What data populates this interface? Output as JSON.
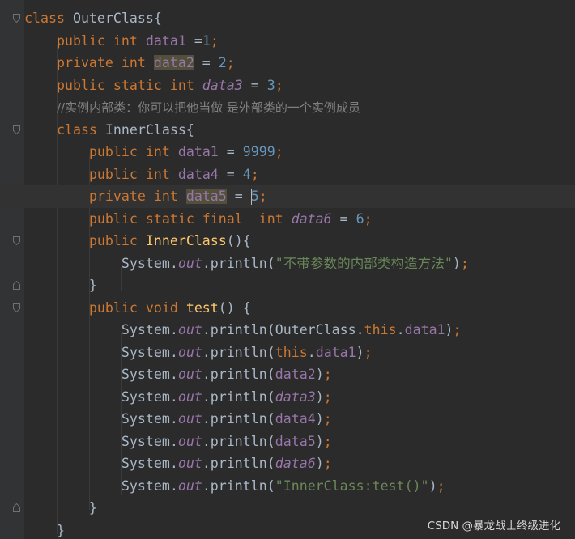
{
  "editor": {
    "lines": [
      {
        "fold": "open",
        "tokens": [
          {
            "t": "kw",
            "v": "class "
          },
          {
            "t": "plain",
            "v": "OuterClass{"
          }
        ]
      },
      {
        "tokens": [
          {
            "t": "plain",
            "v": "    "
          },
          {
            "t": "kw",
            "v": "public int "
          },
          {
            "t": "inst",
            "v": "data1 "
          },
          {
            "t": "plain",
            "v": "="
          },
          {
            "t": "num",
            "v": "1"
          },
          {
            "t": "kw",
            "v": ";"
          }
        ]
      },
      {
        "tokens": [
          {
            "t": "plain",
            "v": "    "
          },
          {
            "t": "kw",
            "v": "private int "
          },
          {
            "t": "inst",
            "v": "data2",
            "hl": true
          },
          {
            "t": "plain",
            "v": " = "
          },
          {
            "t": "num",
            "v": "2"
          },
          {
            "t": "kw",
            "v": ";"
          }
        ]
      },
      {
        "tokens": [
          {
            "t": "plain",
            "v": "    "
          },
          {
            "t": "kw",
            "v": "public static int "
          },
          {
            "t": "static",
            "v": "data3"
          },
          {
            "t": "plain",
            "v": " = "
          },
          {
            "t": "num",
            "v": "3"
          },
          {
            "t": "kw",
            "v": ";"
          }
        ]
      },
      {
        "tokens": [
          {
            "t": "plain",
            "v": "    "
          },
          {
            "t": "com",
            "v": "//实例内部类：你可以把他当做 是外部类的一个实例成员"
          }
        ]
      },
      {
        "fold": "open",
        "tokens": [
          {
            "t": "plain",
            "v": "    "
          },
          {
            "t": "kw",
            "v": "class "
          },
          {
            "t": "plain",
            "v": "InnerClass{"
          }
        ]
      },
      {
        "tokens": [
          {
            "t": "plain",
            "v": "        "
          },
          {
            "t": "kw",
            "v": "public int "
          },
          {
            "t": "inst",
            "v": "data1"
          },
          {
            "t": "plain",
            "v": " = "
          },
          {
            "t": "num",
            "v": "9999"
          },
          {
            "t": "kw",
            "v": ";"
          }
        ]
      },
      {
        "tokens": [
          {
            "t": "plain",
            "v": "        "
          },
          {
            "t": "kw",
            "v": "public int "
          },
          {
            "t": "inst",
            "v": "data4"
          },
          {
            "t": "plain",
            "v": " = "
          },
          {
            "t": "num",
            "v": "4"
          },
          {
            "t": "kw",
            "v": ";"
          }
        ]
      },
      {
        "current": true,
        "tokens": [
          {
            "t": "plain",
            "v": "        "
          },
          {
            "t": "kw",
            "v": "private int "
          },
          {
            "t": "inst",
            "v": "data5",
            "hl": true
          },
          {
            "t": "plain",
            "v": " = "
          },
          {
            "t": "caret",
            "v": ""
          },
          {
            "t": "num",
            "v": "5"
          },
          {
            "t": "kw",
            "v": ";"
          }
        ]
      },
      {
        "tokens": [
          {
            "t": "plain",
            "v": "        "
          },
          {
            "t": "kw",
            "v": "public static final  int "
          },
          {
            "t": "static",
            "v": "data6"
          },
          {
            "t": "plain",
            "v": " = "
          },
          {
            "t": "num",
            "v": "6"
          },
          {
            "t": "kw",
            "v": ";"
          }
        ]
      },
      {
        "fold": "open",
        "tokens": [
          {
            "t": "plain",
            "v": "        "
          },
          {
            "t": "kw",
            "v": "public "
          },
          {
            "t": "fn",
            "v": "InnerClass"
          },
          {
            "t": "plain",
            "v": "(){"
          }
        ]
      },
      {
        "tokens": [
          {
            "t": "plain",
            "v": "            System."
          },
          {
            "t": "static",
            "v": "out"
          },
          {
            "t": "plain",
            "v": ".println("
          },
          {
            "t": "str",
            "v": "\"不带参数的内部类构造方法\""
          },
          {
            "t": "plain",
            "v": ")"
          },
          {
            "t": "kw",
            "v": ";"
          }
        ]
      },
      {
        "fold": "close",
        "tokens": [
          {
            "t": "plain",
            "v": "        }"
          }
        ]
      },
      {
        "fold": "open",
        "tokens": [
          {
            "t": "plain",
            "v": "        "
          },
          {
            "t": "kw",
            "v": "public void "
          },
          {
            "t": "fn",
            "v": "test"
          },
          {
            "t": "plain",
            "v": "() {"
          }
        ]
      },
      {
        "tokens": [
          {
            "t": "plain",
            "v": "            System."
          },
          {
            "t": "static",
            "v": "out"
          },
          {
            "t": "plain",
            "v": ".println(OuterClass."
          },
          {
            "t": "kw",
            "v": "this"
          },
          {
            "t": "plain",
            "v": "."
          },
          {
            "t": "inst",
            "v": "data1"
          },
          {
            "t": "plain",
            "v": ")"
          },
          {
            "t": "kw",
            "v": ";"
          }
        ]
      },
      {
        "tokens": [
          {
            "t": "plain",
            "v": "            System."
          },
          {
            "t": "static",
            "v": "out"
          },
          {
            "t": "plain",
            "v": ".println("
          },
          {
            "t": "kw",
            "v": "this"
          },
          {
            "t": "plain",
            "v": "."
          },
          {
            "t": "inst",
            "v": "data1"
          },
          {
            "t": "plain",
            "v": ")"
          },
          {
            "t": "kw",
            "v": ";"
          }
        ]
      },
      {
        "tokens": [
          {
            "t": "plain",
            "v": "            System."
          },
          {
            "t": "static",
            "v": "out"
          },
          {
            "t": "plain",
            "v": ".println("
          },
          {
            "t": "inst",
            "v": "data2"
          },
          {
            "t": "plain",
            "v": ")"
          },
          {
            "t": "kw",
            "v": ";"
          }
        ]
      },
      {
        "tokens": [
          {
            "t": "plain",
            "v": "            System."
          },
          {
            "t": "static",
            "v": "out"
          },
          {
            "t": "plain",
            "v": ".println("
          },
          {
            "t": "static",
            "v": "data3"
          },
          {
            "t": "plain",
            "v": ")"
          },
          {
            "t": "kw",
            "v": ";"
          }
        ]
      },
      {
        "tokens": [
          {
            "t": "plain",
            "v": "            System."
          },
          {
            "t": "static",
            "v": "out"
          },
          {
            "t": "plain",
            "v": ".println("
          },
          {
            "t": "inst",
            "v": "data4"
          },
          {
            "t": "plain",
            "v": ")"
          },
          {
            "t": "kw",
            "v": ";"
          }
        ]
      },
      {
        "tokens": [
          {
            "t": "plain",
            "v": "            System."
          },
          {
            "t": "static",
            "v": "out"
          },
          {
            "t": "plain",
            "v": ".println("
          },
          {
            "t": "inst",
            "v": "data5"
          },
          {
            "t": "plain",
            "v": ")"
          },
          {
            "t": "kw",
            "v": ";"
          }
        ]
      },
      {
        "tokens": [
          {
            "t": "plain",
            "v": "            System."
          },
          {
            "t": "static",
            "v": "out"
          },
          {
            "t": "plain",
            "v": ".println("
          },
          {
            "t": "static",
            "v": "data6"
          },
          {
            "t": "plain",
            "v": ")"
          },
          {
            "t": "kw",
            "v": ";"
          }
        ]
      },
      {
        "tokens": [
          {
            "t": "plain",
            "v": "            System."
          },
          {
            "t": "static",
            "v": "out"
          },
          {
            "t": "plain",
            "v": ".println("
          },
          {
            "t": "str",
            "v": "\"InnerClass:test()\""
          },
          {
            "t": "plain",
            "v": ")"
          },
          {
            "t": "kw",
            "v": ";"
          }
        ]
      },
      {
        "fold": "close",
        "tokens": [
          {
            "t": "plain",
            "v": "        }"
          }
        ]
      },
      {
        "tokens": [
          {
            "t": "plain",
            "v": "    }"
          }
        ]
      }
    ]
  },
  "watermark": "CSDN @暴龙战士终级进化",
  "colors": {
    "background": "#2b2b2b",
    "keyword": "#cc7832",
    "field": "#9876aa",
    "number": "#6897bb",
    "string": "#6a8759",
    "comment": "#808080",
    "method": "#ffc66d",
    "text": "#a9b7c6",
    "highlight": "#52503a"
  }
}
